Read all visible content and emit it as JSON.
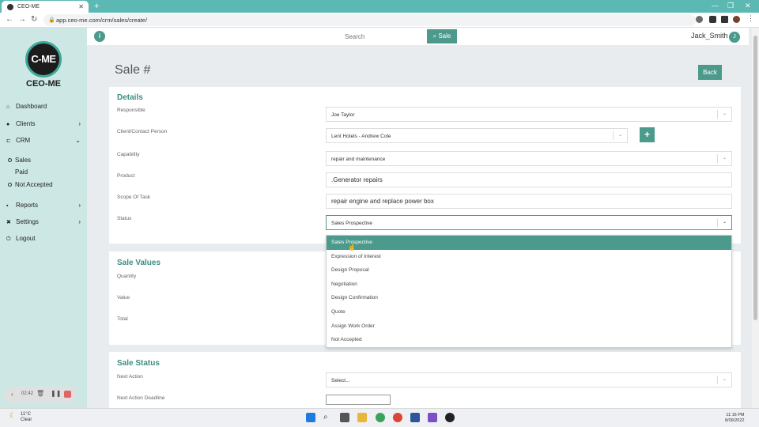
{
  "browser": {
    "tab_title": "CEO-ME",
    "tab_close": "✕",
    "new_tab": "+",
    "url": "app.ceo-me.com/crm/sales/create/"
  },
  "sidebar": {
    "logo_text": "CEO-ME",
    "logo_mark": "C-ME",
    "items": [
      {
        "label": "Dashboard",
        "icon": "home-icon"
      },
      {
        "label": "Clients",
        "icon": "clients-icon",
        "chevron": "›"
      },
      {
        "label": "CRM",
        "icon": "crm-icon",
        "chevron": "⌄"
      },
      {
        "label": "Reports",
        "icon": "reports-icon",
        "chevron": "›"
      },
      {
        "label": "Settings",
        "icon": "settings-icon",
        "chevron": "›"
      },
      {
        "label": "Logout",
        "icon": "logout-icon"
      }
    ],
    "crm_subitems": [
      "Sales",
      "Paid",
      "Not Accepted"
    ],
    "recorder_time": "02:42"
  },
  "topbar": {
    "info": "i",
    "search_placeholder": "Search",
    "search_button": "Sale",
    "user_name": "Jack_Smith",
    "user_initial": "J"
  },
  "page": {
    "title": "Sale #",
    "back_label": "Back"
  },
  "details": {
    "title": "Details",
    "labels": {
      "responsible": "Responsible",
      "client": "Client/Contact Person",
      "capability": "Capability",
      "product": "Product",
      "scope": "Scope Of Task",
      "status": "Status"
    },
    "values": {
      "responsible": "Joe Taylor",
      "client": "Lent Hotels - Andrew Cole",
      "capability": "repair and maintenance",
      "product": ".Generator repairs",
      "scope": "repair engine and replace power box",
      "status": "Sales Prospective"
    },
    "add_button": "+"
  },
  "status_options": [
    "Sales Prospective",
    "Expression of Interest",
    "Design Proposal",
    "Negotiation",
    "Design Confirmation",
    "Quote",
    "Assign Work Order",
    "Not Accepted"
  ],
  "sale_values": {
    "title": "Sale Values",
    "labels": {
      "quantity": "Quantity",
      "value": "Value",
      "total": "Total"
    }
  },
  "sale_status": {
    "title": "Sale Status",
    "labels": {
      "next_action": "Next Action",
      "next_action_deadline": "Next Action Deadline"
    },
    "next_action_placeholder": "Select..."
  },
  "taskbar": {
    "temperature": "11°C",
    "weather": "Clear",
    "time": "11:16 PM",
    "date": "8/09/2022"
  },
  "colors": {
    "accent": "#4b9a8c",
    "sidebar_bg": "#cde8e4",
    "browser_bar": "#5bb8b2"
  }
}
